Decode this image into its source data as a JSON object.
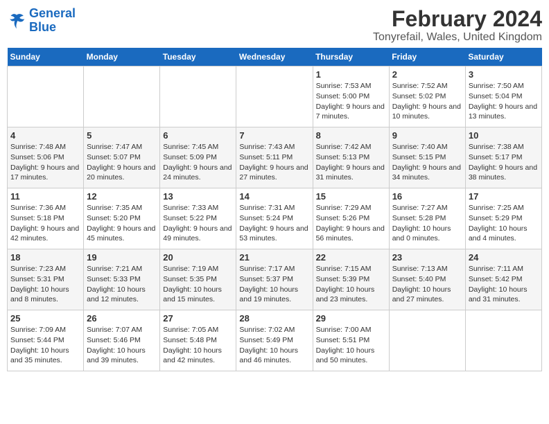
{
  "header": {
    "logo_general": "General",
    "logo_blue": "Blue",
    "title": "February 2024",
    "subtitle": "Tonyrefail, Wales, United Kingdom"
  },
  "weekdays": [
    "Sunday",
    "Monday",
    "Tuesday",
    "Wednesday",
    "Thursday",
    "Friday",
    "Saturday"
  ],
  "weeks": [
    [
      {
        "day": "",
        "sunrise": "",
        "sunset": "",
        "daylight": ""
      },
      {
        "day": "",
        "sunrise": "",
        "sunset": "",
        "daylight": ""
      },
      {
        "day": "",
        "sunrise": "",
        "sunset": "",
        "daylight": ""
      },
      {
        "day": "",
        "sunrise": "",
        "sunset": "",
        "daylight": ""
      },
      {
        "day": "1",
        "sunrise": "Sunrise: 7:53 AM",
        "sunset": "Sunset: 5:00 PM",
        "daylight": "Daylight: 9 hours and 7 minutes."
      },
      {
        "day": "2",
        "sunrise": "Sunrise: 7:52 AM",
        "sunset": "Sunset: 5:02 PM",
        "daylight": "Daylight: 9 hours and 10 minutes."
      },
      {
        "day": "3",
        "sunrise": "Sunrise: 7:50 AM",
        "sunset": "Sunset: 5:04 PM",
        "daylight": "Daylight: 9 hours and 13 minutes."
      }
    ],
    [
      {
        "day": "4",
        "sunrise": "Sunrise: 7:48 AM",
        "sunset": "Sunset: 5:06 PM",
        "daylight": "Daylight: 9 hours and 17 minutes."
      },
      {
        "day": "5",
        "sunrise": "Sunrise: 7:47 AM",
        "sunset": "Sunset: 5:07 PM",
        "daylight": "Daylight: 9 hours and 20 minutes."
      },
      {
        "day": "6",
        "sunrise": "Sunrise: 7:45 AM",
        "sunset": "Sunset: 5:09 PM",
        "daylight": "Daylight: 9 hours and 24 minutes."
      },
      {
        "day": "7",
        "sunrise": "Sunrise: 7:43 AM",
        "sunset": "Sunset: 5:11 PM",
        "daylight": "Daylight: 9 hours and 27 minutes."
      },
      {
        "day": "8",
        "sunrise": "Sunrise: 7:42 AM",
        "sunset": "Sunset: 5:13 PM",
        "daylight": "Daylight: 9 hours and 31 minutes."
      },
      {
        "day": "9",
        "sunrise": "Sunrise: 7:40 AM",
        "sunset": "Sunset: 5:15 PM",
        "daylight": "Daylight: 9 hours and 34 minutes."
      },
      {
        "day": "10",
        "sunrise": "Sunrise: 7:38 AM",
        "sunset": "Sunset: 5:17 PM",
        "daylight": "Daylight: 9 hours and 38 minutes."
      }
    ],
    [
      {
        "day": "11",
        "sunrise": "Sunrise: 7:36 AM",
        "sunset": "Sunset: 5:18 PM",
        "daylight": "Daylight: 9 hours and 42 minutes."
      },
      {
        "day": "12",
        "sunrise": "Sunrise: 7:35 AM",
        "sunset": "Sunset: 5:20 PM",
        "daylight": "Daylight: 9 hours and 45 minutes."
      },
      {
        "day": "13",
        "sunrise": "Sunrise: 7:33 AM",
        "sunset": "Sunset: 5:22 PM",
        "daylight": "Daylight: 9 hours and 49 minutes."
      },
      {
        "day": "14",
        "sunrise": "Sunrise: 7:31 AM",
        "sunset": "Sunset: 5:24 PM",
        "daylight": "Daylight: 9 hours and 53 minutes."
      },
      {
        "day": "15",
        "sunrise": "Sunrise: 7:29 AM",
        "sunset": "Sunset: 5:26 PM",
        "daylight": "Daylight: 9 hours and 56 minutes."
      },
      {
        "day": "16",
        "sunrise": "Sunrise: 7:27 AM",
        "sunset": "Sunset: 5:28 PM",
        "daylight": "Daylight: 10 hours and 0 minutes."
      },
      {
        "day": "17",
        "sunrise": "Sunrise: 7:25 AM",
        "sunset": "Sunset: 5:29 PM",
        "daylight": "Daylight: 10 hours and 4 minutes."
      }
    ],
    [
      {
        "day": "18",
        "sunrise": "Sunrise: 7:23 AM",
        "sunset": "Sunset: 5:31 PM",
        "daylight": "Daylight: 10 hours and 8 minutes."
      },
      {
        "day": "19",
        "sunrise": "Sunrise: 7:21 AM",
        "sunset": "Sunset: 5:33 PM",
        "daylight": "Daylight: 10 hours and 12 minutes."
      },
      {
        "day": "20",
        "sunrise": "Sunrise: 7:19 AM",
        "sunset": "Sunset: 5:35 PM",
        "daylight": "Daylight: 10 hours and 15 minutes."
      },
      {
        "day": "21",
        "sunrise": "Sunrise: 7:17 AM",
        "sunset": "Sunset: 5:37 PM",
        "daylight": "Daylight: 10 hours and 19 minutes."
      },
      {
        "day": "22",
        "sunrise": "Sunrise: 7:15 AM",
        "sunset": "Sunset: 5:39 PM",
        "daylight": "Daylight: 10 hours and 23 minutes."
      },
      {
        "day": "23",
        "sunrise": "Sunrise: 7:13 AM",
        "sunset": "Sunset: 5:40 PM",
        "daylight": "Daylight: 10 hours and 27 minutes."
      },
      {
        "day": "24",
        "sunrise": "Sunrise: 7:11 AM",
        "sunset": "Sunset: 5:42 PM",
        "daylight": "Daylight: 10 hours and 31 minutes."
      }
    ],
    [
      {
        "day": "25",
        "sunrise": "Sunrise: 7:09 AM",
        "sunset": "Sunset: 5:44 PM",
        "daylight": "Daylight: 10 hours and 35 minutes."
      },
      {
        "day": "26",
        "sunrise": "Sunrise: 7:07 AM",
        "sunset": "Sunset: 5:46 PM",
        "daylight": "Daylight: 10 hours and 39 minutes."
      },
      {
        "day": "27",
        "sunrise": "Sunrise: 7:05 AM",
        "sunset": "Sunset: 5:48 PM",
        "daylight": "Daylight: 10 hours and 42 minutes."
      },
      {
        "day": "28",
        "sunrise": "Sunrise: 7:02 AM",
        "sunset": "Sunset: 5:49 PM",
        "daylight": "Daylight: 10 hours and 46 minutes."
      },
      {
        "day": "29",
        "sunrise": "Sunrise: 7:00 AM",
        "sunset": "Sunset: 5:51 PM",
        "daylight": "Daylight: 10 hours and 50 minutes."
      },
      {
        "day": "",
        "sunrise": "",
        "sunset": "",
        "daylight": ""
      },
      {
        "day": "",
        "sunrise": "",
        "sunset": "",
        "daylight": ""
      }
    ]
  ]
}
